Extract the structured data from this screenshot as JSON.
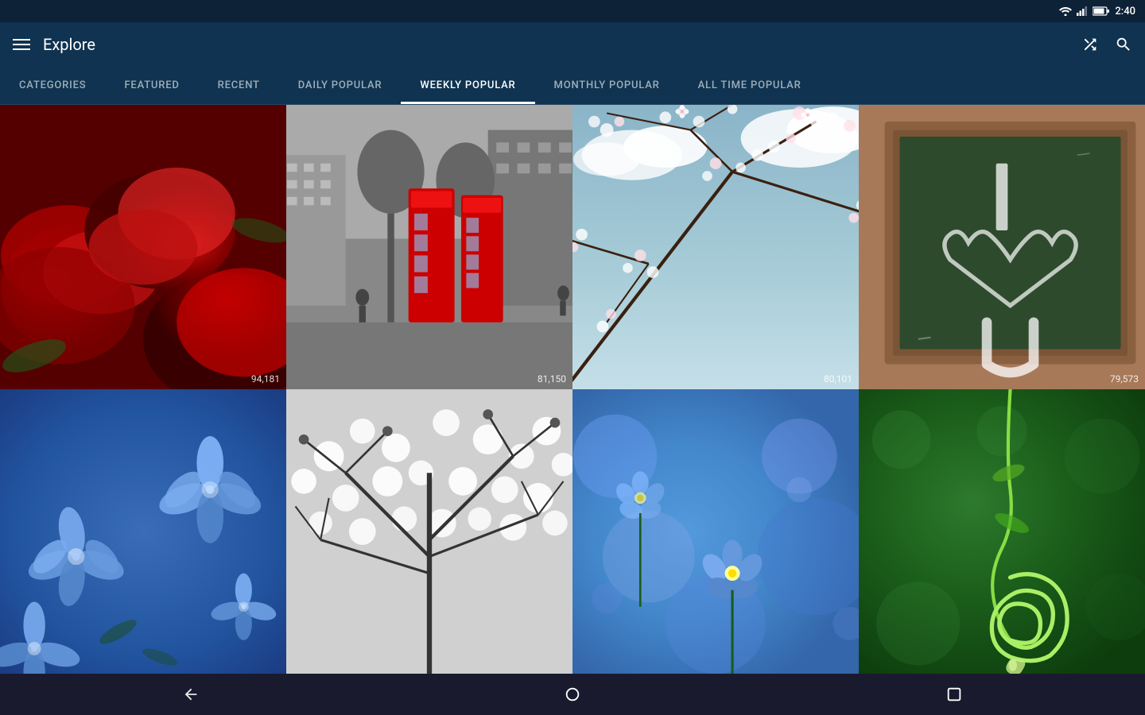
{
  "statusBar": {
    "time": "2:40",
    "icons": [
      "wifi",
      "signal",
      "battery"
    ]
  },
  "appBar": {
    "title": "Explore",
    "actions": [
      "shuffle",
      "search"
    ]
  },
  "tabs": [
    {
      "id": "categories",
      "label": "CATEGORIES",
      "active": false
    },
    {
      "id": "featured",
      "label": "FEATURED",
      "active": false
    },
    {
      "id": "recent",
      "label": "RECENT",
      "active": false
    },
    {
      "id": "daily-popular",
      "label": "DAILY POPULAR",
      "active": false
    },
    {
      "id": "weekly-popular",
      "label": "WEEKLY POPULAR",
      "active": true
    },
    {
      "id": "monthly-popular",
      "label": "MONTHLY POPULAR",
      "active": false
    },
    {
      "id": "all-time-popular",
      "label": "ALL TIME POPULAR",
      "active": false
    }
  ],
  "grid": {
    "rows": [
      [
        {
          "id": "cell-1",
          "count": "94,181",
          "type": "roses"
        },
        {
          "id": "cell-2",
          "count": "81,150",
          "type": "phone-booth"
        },
        {
          "id": "cell-3",
          "count": "80,101",
          "type": "cherry-blossom"
        },
        {
          "id": "cell-4",
          "count": "79,573",
          "type": "chalkboard"
        }
      ],
      [
        {
          "id": "cell-5",
          "count": "",
          "type": "blue-flowers"
        },
        {
          "id": "cell-6",
          "count": "",
          "type": "black-white-tree"
        },
        {
          "id": "cell-7",
          "count": "",
          "type": "forget-me-not"
        },
        {
          "id": "cell-8",
          "count": "",
          "type": "green-spiral"
        }
      ]
    ]
  },
  "bottomNav": {
    "back": "◁",
    "home": "○",
    "recents": "□"
  },
  "colors": {
    "appBarBg": "#0f3350",
    "statusBarBg": "#0d2137",
    "activeTabLine": "#ffffff",
    "bottomNavBg": "#1a1a2e"
  }
}
